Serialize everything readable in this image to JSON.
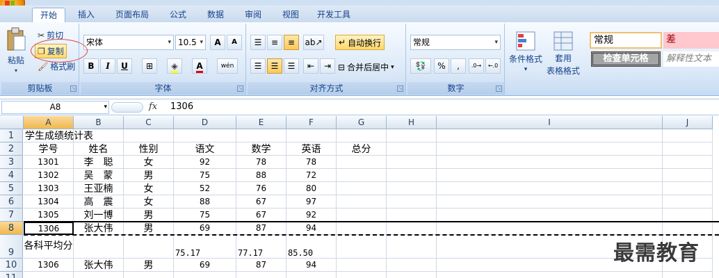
{
  "ribbon_tabs": [
    "开始",
    "插入",
    "页面布局",
    "公式",
    "数据",
    "审阅",
    "视图",
    "开发工具"
  ],
  "clipboard": {
    "paste": "粘贴",
    "cut": "剪切",
    "copy": "复制",
    "format_painter": "格式刷",
    "label": "剪贴板"
  },
  "font": {
    "name": "宋体",
    "size": "10.5",
    "label": "字体",
    "grow": "A",
    "shrink": "A",
    "bold": "B",
    "italic": "I",
    "underline": "U",
    "phonetic": "wén"
  },
  "alignment": {
    "wrap": "自动换行",
    "merge": "合并后居中",
    "label": "对齐方式"
  },
  "number": {
    "format": "常规",
    "percent": "%",
    "comma": ",",
    "label": "数字"
  },
  "styles": {
    "conditional_line1": "条件格式",
    "table_line1": "套用",
    "table_line2": "表格格式",
    "normal": "常规",
    "bad": "差",
    "check_cell": "检查单元格",
    "explanatory": "解释性文本"
  },
  "formula_bar": {
    "name_box": "A8",
    "fx": "fx",
    "value": "1306"
  },
  "columns": [
    "A",
    "B",
    "C",
    "D",
    "E",
    "F",
    "G",
    "H",
    "I",
    "J"
  ],
  "rows": [
    {
      "num": "1",
      "cells": [
        "学生成绩统计表",
        "",
        "",
        "",
        "",
        "",
        "",
        ""
      ]
    },
    {
      "num": "2",
      "cells": [
        "学号",
        "姓名",
        "性别",
        "语文",
        "数学",
        "英语",
        "总分",
        ""
      ]
    },
    {
      "num": "3",
      "cells": [
        "1301",
        "李　聪",
        "女",
        "92",
        "78",
        "78",
        "",
        ""
      ]
    },
    {
      "num": "4",
      "cells": [
        "1302",
        "吴　蒙",
        "男",
        "75",
        "88",
        "72",
        "",
        ""
      ]
    },
    {
      "num": "5",
      "cells": [
        "1303",
        "王亚楠",
        "女",
        "52",
        "76",
        "80",
        "",
        ""
      ]
    },
    {
      "num": "6",
      "cells": [
        "1304",
        "高　震",
        "女",
        "88",
        "67",
        "97",
        "",
        ""
      ]
    },
    {
      "num": "7",
      "cells": [
        "1305",
        "刘一博",
        "男",
        "75",
        "67",
        "92",
        "",
        ""
      ]
    },
    {
      "num": "8",
      "cells": [
        "1306",
        "张大伟",
        "男",
        "69",
        "87",
        "94",
        "",
        ""
      ]
    },
    {
      "num": "9",
      "cells": [
        "各科平均分",
        "",
        "",
        "75.17",
        "77.17",
        "85.50",
        "",
        ""
      ]
    },
    {
      "num": "10",
      "cells": [
        "1306",
        "张大伟",
        "男",
        "69",
        "87",
        "94",
        "",
        ""
      ]
    },
    {
      "num": "11",
      "cells": [
        "",
        "",
        "",
        "",
        "",
        "",
        "",
        ""
      ]
    }
  ],
  "watermark": "最需教育"
}
